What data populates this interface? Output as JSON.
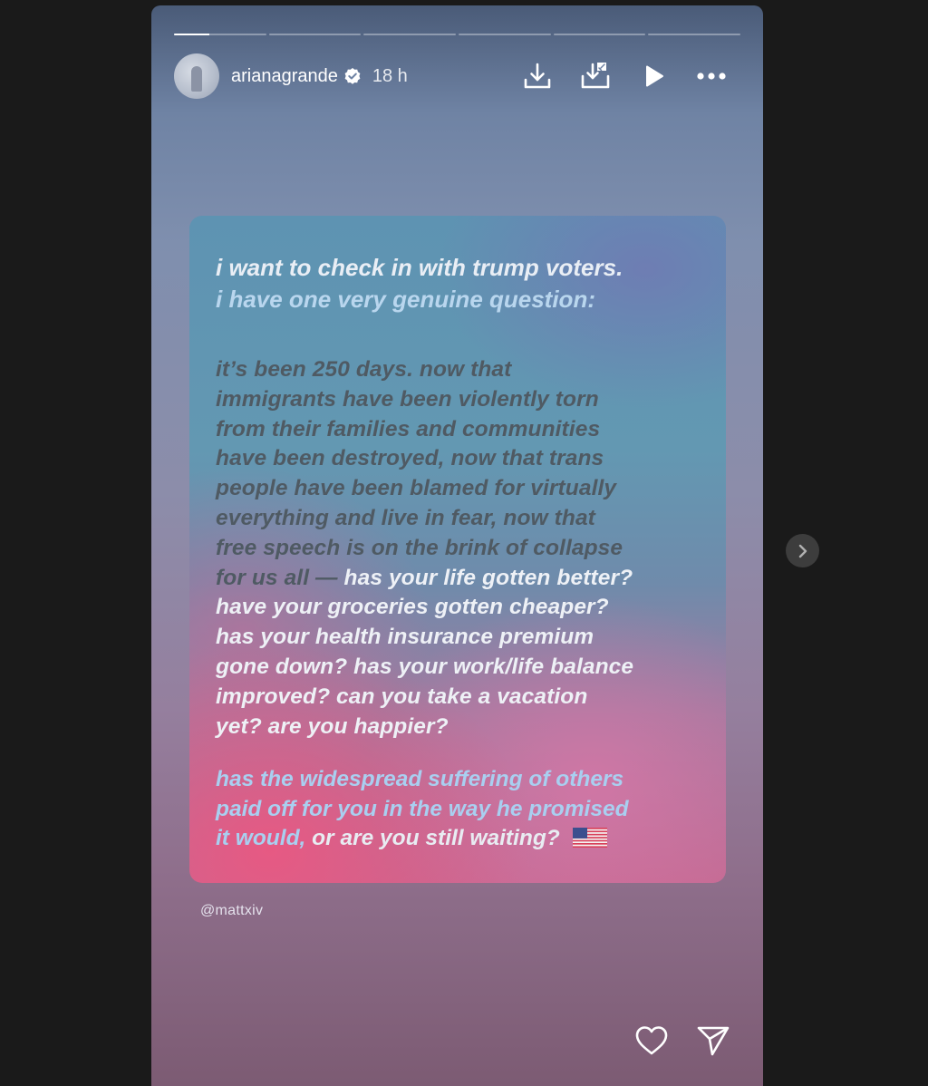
{
  "story": {
    "progress": {
      "segment_count": 6,
      "active_index": 0,
      "active_fraction": 0.38
    },
    "user": {
      "username": "arianagrande",
      "time": "18 h",
      "verified": true
    },
    "header_icons": [
      "download-icon",
      "save-to-collection-icon",
      "play-icon",
      "more-options-icon"
    ],
    "card": {
      "intro_line1": "i want to check in with trump voters.",
      "intro_line2": "i have one very genuine question:",
      "body_lines": [
        "it’s been 250 days. now that",
        "immigrants have been violently torn",
        "from their families and communities",
        "have been destroyed, now that trans",
        "people have been blamed for virtually",
        "everything and live in fear, now that",
        "free speech is on the brink of collapse"
      ],
      "body_line8_dark": "for us all — ",
      "body_line8_light": "has your life gotten better?",
      "light_lines": [
        "have your groceries gotten cheaper?",
        "has your health insurance premium",
        "gone down? has your work/life balance",
        "improved? can you take a vacation",
        "yet? are you happier?"
      ],
      "closing_line1": "has the widespread suffering of others",
      "closing_line2": "paid off for you in the way he promised",
      "closing_line3_blue": "it would,",
      "closing_line3_grey": " or are you still waiting?",
      "flag_emoji": "us-flag-icon"
    },
    "mention": "@mattxiv",
    "footer_icons": [
      "heart-icon",
      "share-icon"
    ]
  },
  "navigation": {
    "next_icon": "chevron-right-icon"
  },
  "colors": {
    "page_bg": "#1a1a1a",
    "intro_blue": "#b9d6ee",
    "body_dark": "#4f5a63",
    "closing_blue": "#a9cff0"
  }
}
